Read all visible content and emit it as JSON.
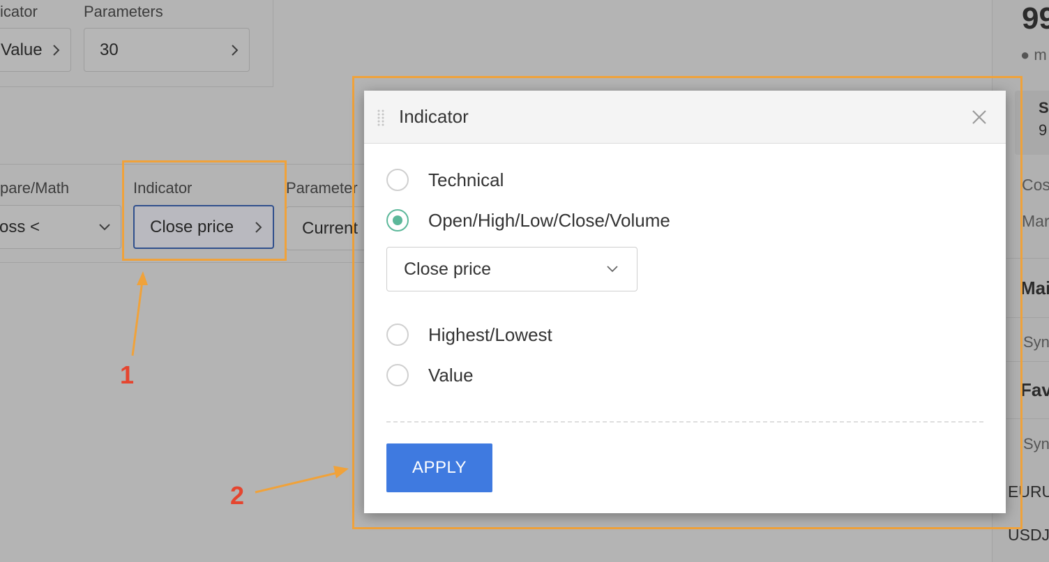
{
  "background": {
    "top_panel": {
      "indicator_label": "icator",
      "indicator_value": "Value",
      "parameters_label": "Parameters",
      "parameters_value": "30"
    },
    "condition_row": {
      "compare_label": "pare/Math",
      "compare_value": "oss <",
      "indicator_label": "Indicator",
      "indicator_value": "Close price",
      "parameters_label": "Parameter",
      "parameters_value": "Current"
    },
    "right_column": {
      "big_number": "99",
      "dot_text": "● m",
      "box_title": "S",
      "box_value": "9",
      "row1": "Cos",
      "row2": "Mar",
      "section_main": "Mai",
      "sym1": "Syn",
      "section_fav": "Fav",
      "sym2": "Syn",
      "pair1": "EURU",
      "pair2": "USDJ"
    }
  },
  "annotations": {
    "label_1": "1",
    "label_2": "2",
    "color_box": "#f0a23a",
    "color_number": "#e5452f"
  },
  "modal": {
    "title": "Indicator",
    "options": [
      {
        "label": "Technical",
        "checked": false
      },
      {
        "label": "Open/High/Low/Close/Volume",
        "checked": true
      },
      {
        "label": "Highest/Lowest",
        "checked": false
      },
      {
        "label": "Value",
        "checked": false
      }
    ],
    "select_value": "Close price",
    "apply_label": "APPLY",
    "accent_color": "#5cb89a",
    "button_color": "#3f7ae0",
    "icons": [
      "drag-handle-icon",
      "close-icon",
      "chevron-down-icon"
    ]
  }
}
